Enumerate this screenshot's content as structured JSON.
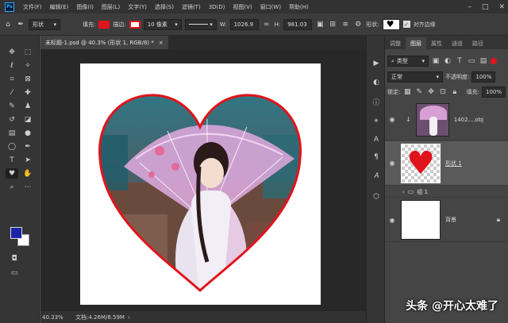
{
  "app": {
    "logo": "Ps"
  },
  "menu": [
    "文件(F)",
    "编辑(E)",
    "图像(I)",
    "图层(L)",
    "文字(Y)",
    "选择(S)",
    "滤镜(T)",
    "3D(D)",
    "视图(V)",
    "窗口(W)",
    "帮助(H)"
  ],
  "options": {
    "mode": "形状",
    "fill_label": "填充:",
    "stroke_label": "描边:",
    "stroke_width": "10 像素",
    "w_label": "W:",
    "w_value": "1026.9",
    "h_label": "H:",
    "h_value": "981.03",
    "shape_label": "形状:",
    "align_edges": "对齐边缘",
    "fill_color": "#e0141c",
    "stroke_color": "#e0141c"
  },
  "document": {
    "tab_title": "未标题-1.psd @ 40.3% (形状 1, RGB/8) *",
    "close": "×"
  },
  "status": {
    "zoom": "40.33%",
    "doc_info": "文档:4.26M/8.59M",
    "arrow": "›"
  },
  "panel": {
    "tabs": [
      "调整",
      "图层",
      "属性",
      "通道",
      "路径"
    ],
    "active_tab": "图层",
    "kind": "类型",
    "blend_mode": "正常",
    "opacity_label": "不透明度:",
    "opacity_value": "100%",
    "lock_label": "锁定:",
    "fill_label": "填充:",
    "fill_value": "100%",
    "layers": [
      {
        "name": "1402....obj"
      },
      {
        "name": "形状 1"
      },
      {
        "name": "组 1"
      },
      {
        "name": "背景"
      }
    ]
  },
  "watermark": "头条 @开心太难了"
}
